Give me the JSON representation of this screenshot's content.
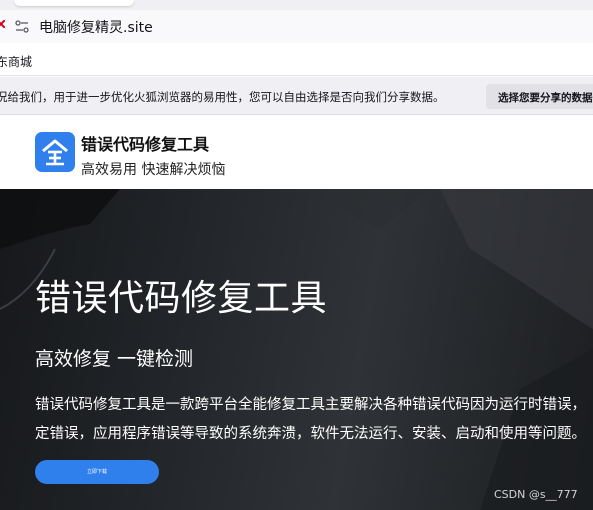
{
  "browser": {
    "url": "电脑修复精灵.site",
    "bookmarks": [
      "东商城"
    ],
    "notification": {
      "message": "况给我们，用于进一步优化火狐浏览器的易用性，您可以自由选择是否向我们分享数据。",
      "button_label": "选择您要分享的数据"
    }
  },
  "site": {
    "logo_icon": "blue-square-logo-icon",
    "name": "错误代码修复工具",
    "slogan": "高效易用 快速解决烦恼"
  },
  "hero": {
    "title": "错误代码修复工具",
    "subtitle": "高效修复 一键检测",
    "description_line1": "错误代码修复工具是一款跨平台全能修复工具主要解决各种错误代码因为运行时错误，",
    "description_line2": "定错误，应用程序错误等导致的系统奔溃，软件无法运行、安装、启动和使用等问题。",
    "button_label": "立即下载"
  },
  "watermark": "CSDN @s__777",
  "colors": {
    "accent": "#2f80ed",
    "hero_background": "#24272b",
    "close_icon": "#d70022"
  }
}
